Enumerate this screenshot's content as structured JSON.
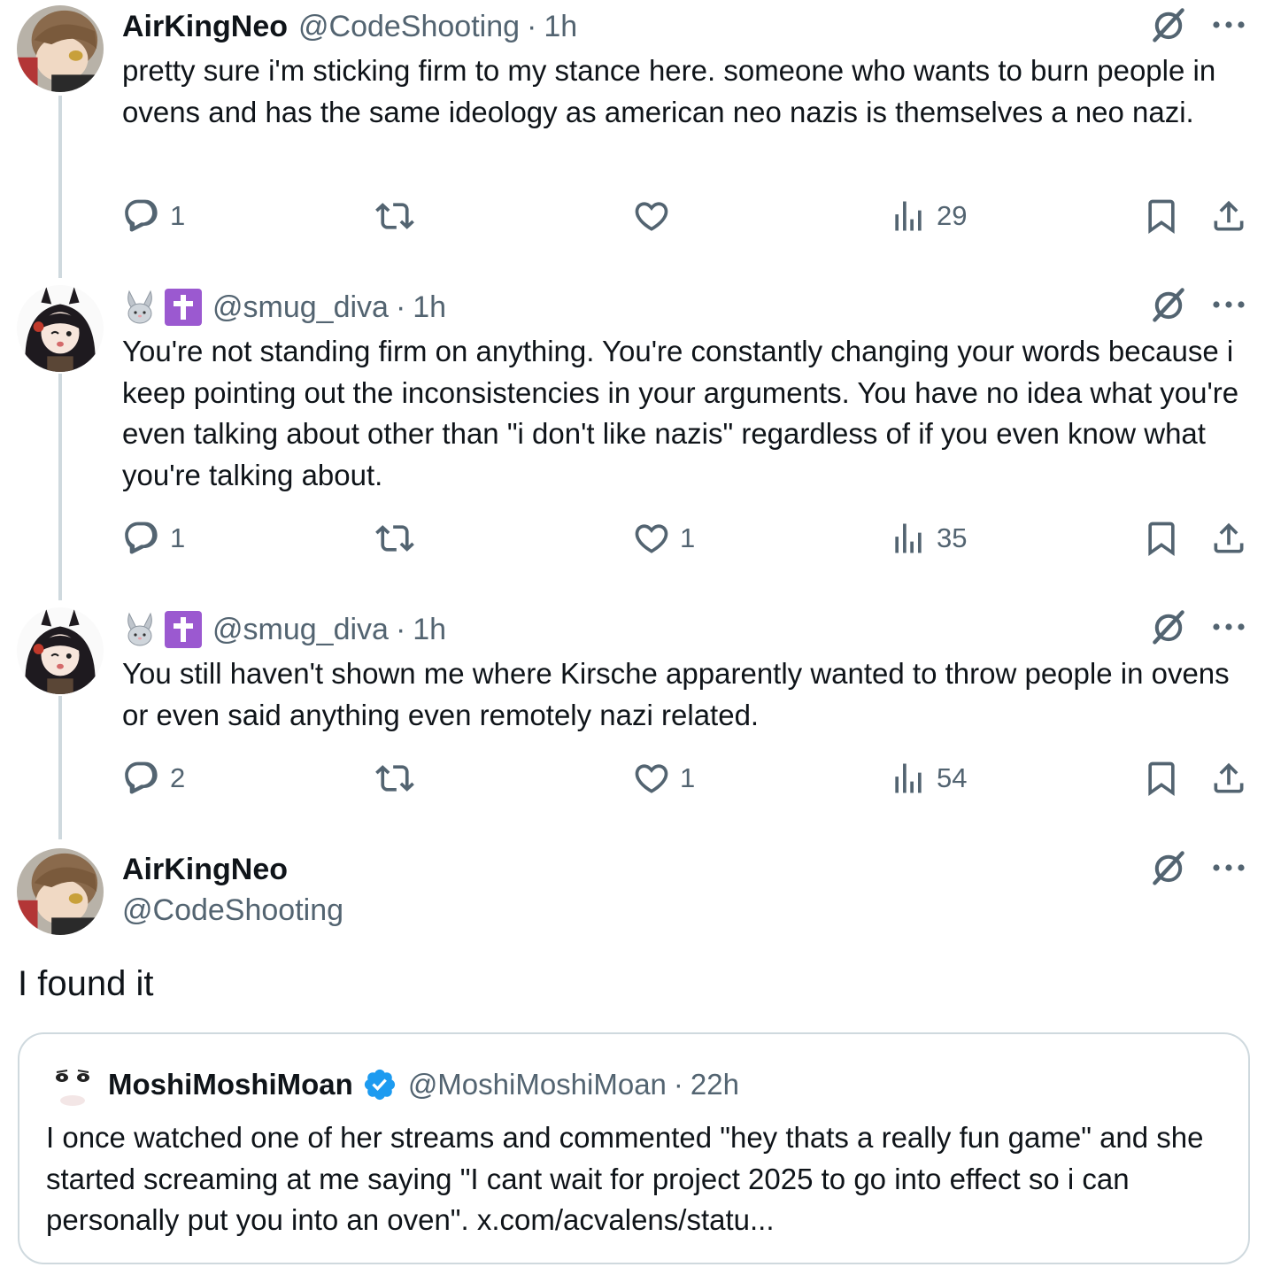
{
  "tweets": [
    {
      "name": "AirKingNeo",
      "handle": "@CodeShooting",
      "time": "1h",
      "text": "pretty sure i'm sticking firm to my stance here. someone who wants to burn people in ovens and has the same ideology as american neo nazis is themselves a neo nazi.",
      "replies": "1",
      "retweets": "",
      "likes": "",
      "views": "29"
    },
    {
      "name": "",
      "handle": "@smug_diva",
      "time": "1h",
      "text": "You're not standing firm on anything. You're constantly changing your words because i keep pointing out the inconsistencies in your arguments. You have no idea what you're even talking about other than \"i don't like nazis\" regardless of if you even know what you're talking about.",
      "replies": "1",
      "retweets": "",
      "likes": "1",
      "views": "35"
    },
    {
      "name": "",
      "handle": "@smug_diva",
      "time": "1h",
      "text": "You still haven't shown me where Kirsche apparently wanted to throw people in ovens or even said anything even remotely nazi related.",
      "replies": "2",
      "retweets": "",
      "likes": "1",
      "views": "54"
    }
  ],
  "main_tweet": {
    "name": "AirKingNeo",
    "handle": "@CodeShooting",
    "text": "I found it"
  },
  "quote": {
    "name": "MoshiMoshiMoan",
    "handle": "@MoshiMoshiMoan",
    "time": "22h",
    "text": "I once watched one of her streams and commented \"hey thats a really fun game\" and she started screaming at me saying \"I cant wait for project 2025 to go into effect so i can personally put you into an oven\". x.com/acvalens/statu..."
  },
  "separator": "·",
  "colors": {
    "text": "#0f1419",
    "secondary": "#536471",
    "thread_line": "#cfd9de",
    "verified": "#1d9bf0",
    "badge_purple": "#9b59d0"
  },
  "icons": [
    "reply-icon",
    "retweet-icon",
    "like-icon",
    "views-icon",
    "bookmark-icon",
    "share-icon",
    "grok-icon",
    "more-icon",
    "verified-icon",
    "bunny-emoji-icon",
    "cross-emoji-icon"
  ]
}
